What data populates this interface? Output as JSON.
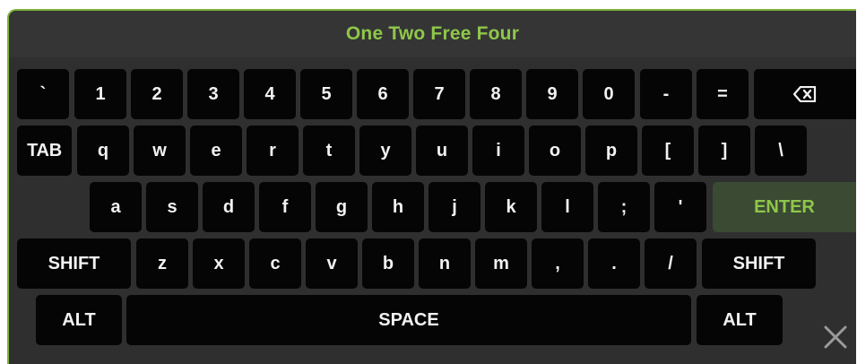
{
  "title": "One Two Free Four",
  "keyboard": {
    "row1": [
      "`",
      "1",
      "2",
      "3",
      "4",
      "5",
      "6",
      "7",
      "8",
      "9",
      "0",
      "-",
      "="
    ],
    "row2": [
      "TAB",
      "q",
      "w",
      "e",
      "r",
      "t",
      "y",
      "u",
      "i",
      "o",
      "p",
      "[",
      "]",
      "\\"
    ],
    "row3": [
      "a",
      "s",
      "d",
      "f",
      "g",
      "h",
      "j",
      "k",
      "l",
      ";",
      "'",
      "ENTER"
    ],
    "row4": [
      "SHIFT",
      "z",
      "x",
      "c",
      "v",
      "b",
      "n",
      "m",
      ",",
      ".",
      "/",
      "SHIFT"
    ],
    "row5": [
      "ALT",
      "SPACE",
      "ALT"
    ],
    "backspace_icon": "backspace-icon"
  },
  "close_icon": "close-icon",
  "colors": {
    "accent": "#8fc74a",
    "background": "#2f2f2f",
    "key": "#050505",
    "enter_key": "#3a4a33",
    "key_text": "#f2f2f2"
  }
}
